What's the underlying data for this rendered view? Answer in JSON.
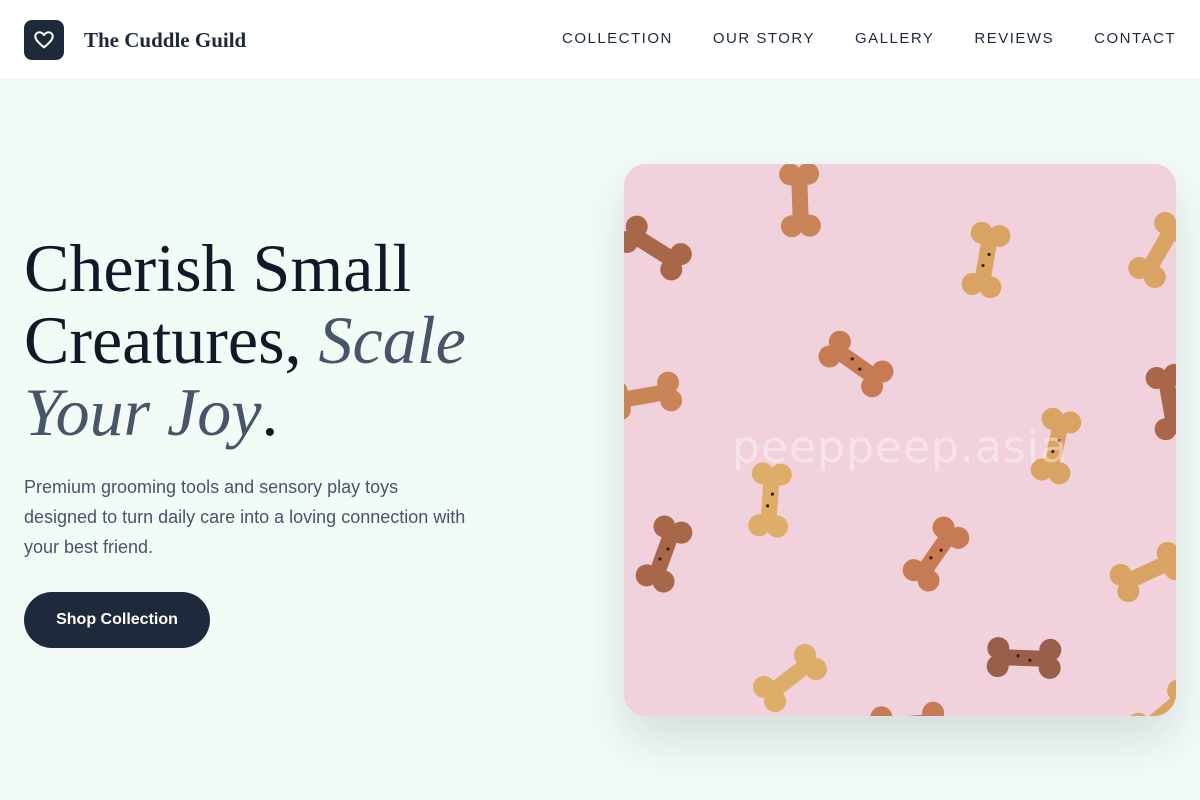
{
  "header": {
    "brand": "The Cuddle Guild",
    "logo_icon": "heart-icon",
    "nav": [
      "COLLECTION",
      "OUR STORY",
      "GALLERY",
      "REVIEWS",
      "CONTACT"
    ]
  },
  "hero": {
    "title_line1": "Cherish Small",
    "title_line2_plain": "Creatures, ",
    "title_line2_italic": "Scale",
    "title_line3_italic": "Your Joy",
    "title_period": ".",
    "subtitle": "Premium grooming tools and sensory play toys designed to turn daily care into a loving connection with your best friend.",
    "cta_label": "Shop Collection",
    "image_watermark": "peeppeep.asia"
  },
  "colors": {
    "background": "#f3fbf7",
    "primary": "#1e293b",
    "accent_italic": "#475569",
    "image_bg": "#f1d2dc"
  }
}
